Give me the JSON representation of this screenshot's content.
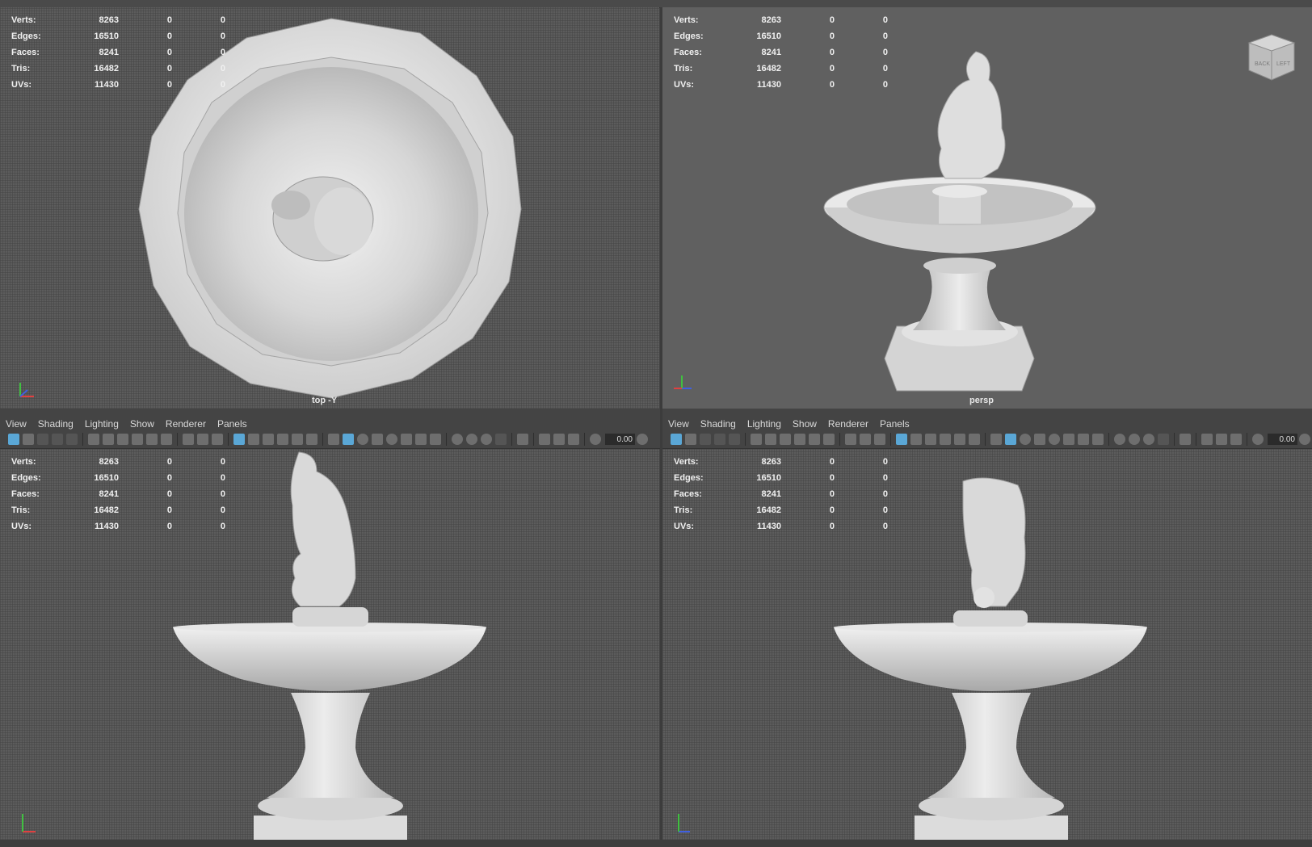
{
  "stats": [
    {
      "label": "Verts:",
      "value": "8263",
      "a": "0",
      "b": "0"
    },
    {
      "label": "Edges:",
      "value": "16510",
      "a": "0",
      "b": "0"
    },
    {
      "label": "Faces:",
      "value": "8241",
      "a": "0",
      "b": "0"
    },
    {
      "label": "Tris:",
      "value": "16482",
      "a": "0",
      "b": "0"
    },
    {
      "label": "UVs:",
      "value": "11430",
      "a": "0",
      "b": "0"
    }
  ],
  "viewports": {
    "top": {
      "camera": "top -Y"
    },
    "persp": {
      "camera": "persp",
      "viewcube_back": "BACK",
      "viewcube_left": "LEFT"
    }
  },
  "menu": [
    "View",
    "Shading",
    "Lighting",
    "Show",
    "Renderer",
    "Panels"
  ],
  "toolbar": {
    "exposure": "0.00"
  },
  "icons": {
    "axis_indicator": "axis-gizmo-icon",
    "select_camera": "select-camera-icon",
    "grid": "grid-toggle-icon",
    "wireframe": "wireframe-icon",
    "smooth_shade": "smooth-shade-icon",
    "exposure": "exposure-icon"
  },
  "colors": {
    "viewport_bg": "#5c5c5c",
    "panel_bg": "#444444",
    "hud_text": "#f0f0f0",
    "icon_active": "#5aa7d6",
    "model": "#d8d8d8"
  }
}
